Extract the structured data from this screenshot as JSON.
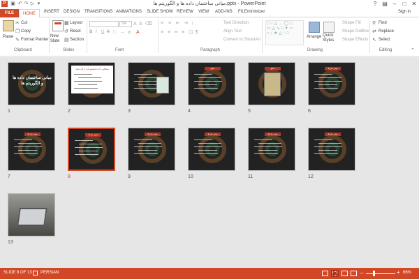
{
  "window": {
    "title": "مبانی ساختمان داده ها و الگوریتم ها.pptx - PowerPoint",
    "help": "?",
    "signin": "Sign in"
  },
  "tabs": [
    "FILE",
    "HOME",
    "INSERT",
    "DESIGN",
    "TRANSITIONS",
    "ANIMATIONS",
    "SLIDE SHOW",
    "REVIEW",
    "VIEW",
    "ADD-INS",
    "FILEminimizer"
  ],
  "clipboard": {
    "paste": "Paste",
    "cut": "Cut",
    "copy": "Copy",
    "format_painter": "Format Painter",
    "label": "Clipboard"
  },
  "slides_group": {
    "new_slide": "New Slide",
    "layout": "Layout",
    "reset": "Reset",
    "section": "Section",
    "label": "Slides"
  },
  "font_group": {
    "size": "54",
    "bold": "B",
    "italic": "I",
    "underline": "U",
    "strike": "S",
    "label": "Font"
  },
  "paragraph_group": {
    "text_direction": "Text Direction",
    "align_text": "Align Text",
    "convert_smartart": "Convert to SmartArt",
    "label": "Paragraph"
  },
  "drawing_group": {
    "arrange": "Arrange",
    "quick_styles": "Quick Styles",
    "shape_fill": "Shape Fill",
    "shape_outline": "Shape Outline",
    "shape_effects": "Shape Effects",
    "label": "Drawing"
  },
  "editing_group": {
    "find": "Find",
    "replace": "Replace",
    "select": "Select",
    "label": "Editing"
  },
  "slides": [
    {
      "number": "1",
      "title": "مبانی ساختمان داده ها و الگوریتم ها",
      "selected": false,
      "kind": "title"
    },
    {
      "number": "2",
      "title": "مطالبی که دانشجو باید ارائه بدهد",
      "selected": false,
      "kind": "whitebox"
    },
    {
      "number": "3",
      "title": "",
      "selected": false,
      "kind": "books"
    },
    {
      "number": "4",
      "title": "منابع",
      "selected": false,
      "kind": "text"
    },
    {
      "number": "5",
      "title": "منابع",
      "selected": false,
      "kind": "image"
    },
    {
      "number": "6",
      "title": "پیش نیاز ها",
      "selected": false,
      "kind": "text"
    },
    {
      "number": "7",
      "title": "پیش نیاز ها",
      "selected": false,
      "kind": "text"
    },
    {
      "number": "8",
      "title": "پیش نیاز ها",
      "selected": true,
      "kind": "text"
    },
    {
      "number": "9",
      "title": "پیش نیاز ها",
      "selected": false,
      "kind": "text"
    },
    {
      "number": "10",
      "title": "پیش نیاز ها",
      "selected": false,
      "kind": "text"
    },
    {
      "number": "11",
      "title": "پیش نیاز ها",
      "selected": false,
      "kind": "text"
    },
    {
      "number": "12",
      "title": "پیش نیاز ها",
      "selected": false,
      "kind": "text"
    },
    {
      "number": "13",
      "title": "",
      "selected": false,
      "kind": "laptop"
    }
  ],
  "status": {
    "slide_info": "SLIDE 8 OF 13",
    "language": "PERSIAN",
    "zoom": "66%"
  },
  "colors": {
    "accent": "#d24726",
    "workspace": "#e6e6e6"
  }
}
